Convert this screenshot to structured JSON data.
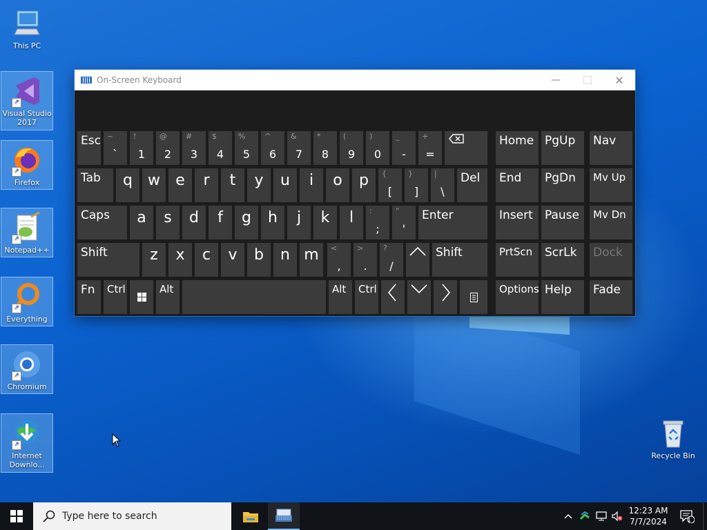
{
  "desktop": {
    "icons": [
      {
        "label": "This PC"
      },
      {
        "label": "Visual Studio 2017"
      },
      {
        "label": "Firefox"
      },
      {
        "label": "Notepad++"
      },
      {
        "label": "Everything"
      },
      {
        "label": "Chromium"
      },
      {
        "label": "Internet Downlo..."
      },
      {
        "label": "Recycle Bin"
      }
    ]
  },
  "osk": {
    "title": "On-Screen Keyboard",
    "row1": [
      {
        "top": "~",
        "bot": "`"
      },
      {
        "top": "!",
        "bot": "1"
      },
      {
        "top": "@",
        "bot": "2"
      },
      {
        "top": "#",
        "bot": "3"
      },
      {
        "top": "$",
        "bot": "4"
      },
      {
        "top": "%",
        "bot": "5"
      },
      {
        "top": "^",
        "bot": "6"
      },
      {
        "top": "&",
        "bot": "7"
      },
      {
        "top": "*",
        "bot": "8"
      },
      {
        "top": "(",
        "bot": "9"
      },
      {
        "top": ")",
        "bot": "0"
      },
      {
        "top": "_",
        "bot": "-"
      },
      {
        "top": "+",
        "bot": "="
      }
    ],
    "row2": [
      "q",
      "w",
      "e",
      "r",
      "t",
      "y",
      "u",
      "i",
      "o",
      "p"
    ],
    "row2_sym": [
      {
        "top": "{",
        "bot": "["
      },
      {
        "top": "}",
        "bot": "]"
      },
      {
        "top": "|",
        "bot": "\\"
      }
    ],
    "row3": [
      "a",
      "s",
      "d",
      "f",
      "g",
      "h",
      "j",
      "k",
      "l"
    ],
    "row3_sym": [
      {
        "top": ":",
        "bot": ";"
      },
      {
        "top": "\"",
        "bot": "'"
      }
    ],
    "row4": [
      "z",
      "x",
      "c",
      "v",
      "b",
      "n",
      "m"
    ],
    "row4_sym": [
      {
        "top": "<",
        "bot": ","
      },
      {
        "top": ">",
        "bot": "."
      },
      {
        "top": "?",
        "bot": "/"
      }
    ],
    "labels": {
      "esc": "Esc",
      "tab": "Tab",
      "caps": "Caps",
      "shift": "Shift",
      "fn": "Fn",
      "ctrl": "Ctrl",
      "alt": "Alt",
      "del": "Del",
      "enter": "Enter",
      "home": "Home",
      "pgup": "PgUp",
      "nav": "Nav",
      "end": "End",
      "pgdn": "PgDn",
      "mvup": "Mv Up",
      "insert": "Insert",
      "pause": "Pause",
      "mvdn": "Mv Dn",
      "prtscn": "PrtScn",
      "scrlk": "ScrLk",
      "dock": "Dock",
      "options": "Options",
      "help": "Help",
      "fade": "Fade"
    }
  },
  "taskbar": {
    "search_placeholder": "Type here to search",
    "time": "12:23 AM",
    "date": "7/7/2024",
    "notification_count": "1"
  }
}
